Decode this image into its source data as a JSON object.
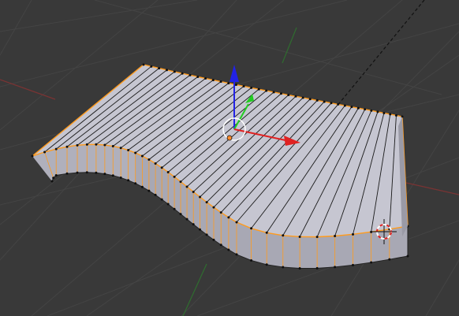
{
  "viewport": {
    "background": "#393939",
    "grid_color": "#444444",
    "axis_x_color": "#7a3333",
    "axis_y_color": "#2f6d2f"
  },
  "mesh": {
    "top_face_color": "#c6c6d1",
    "side_face_color": "#a8a8b4",
    "edge_color": "#1a1a1a",
    "selected_edge_color": "#ff9b1d",
    "vertex_color": "#101010",
    "selection_state": "all-selected"
  },
  "manipulator": {
    "x_color": "#e02222",
    "y_color": "#22cc22",
    "z_color": "#2222e6",
    "center_ring_color": "#ffffff"
  },
  "cursor_3d": {
    "ring_colors": [
      "#e02222",
      "#ffffff"
    ],
    "icon": "3d-cursor-icon"
  },
  "extra_object": {
    "style": "dashed-line",
    "color": "#111111"
  }
}
